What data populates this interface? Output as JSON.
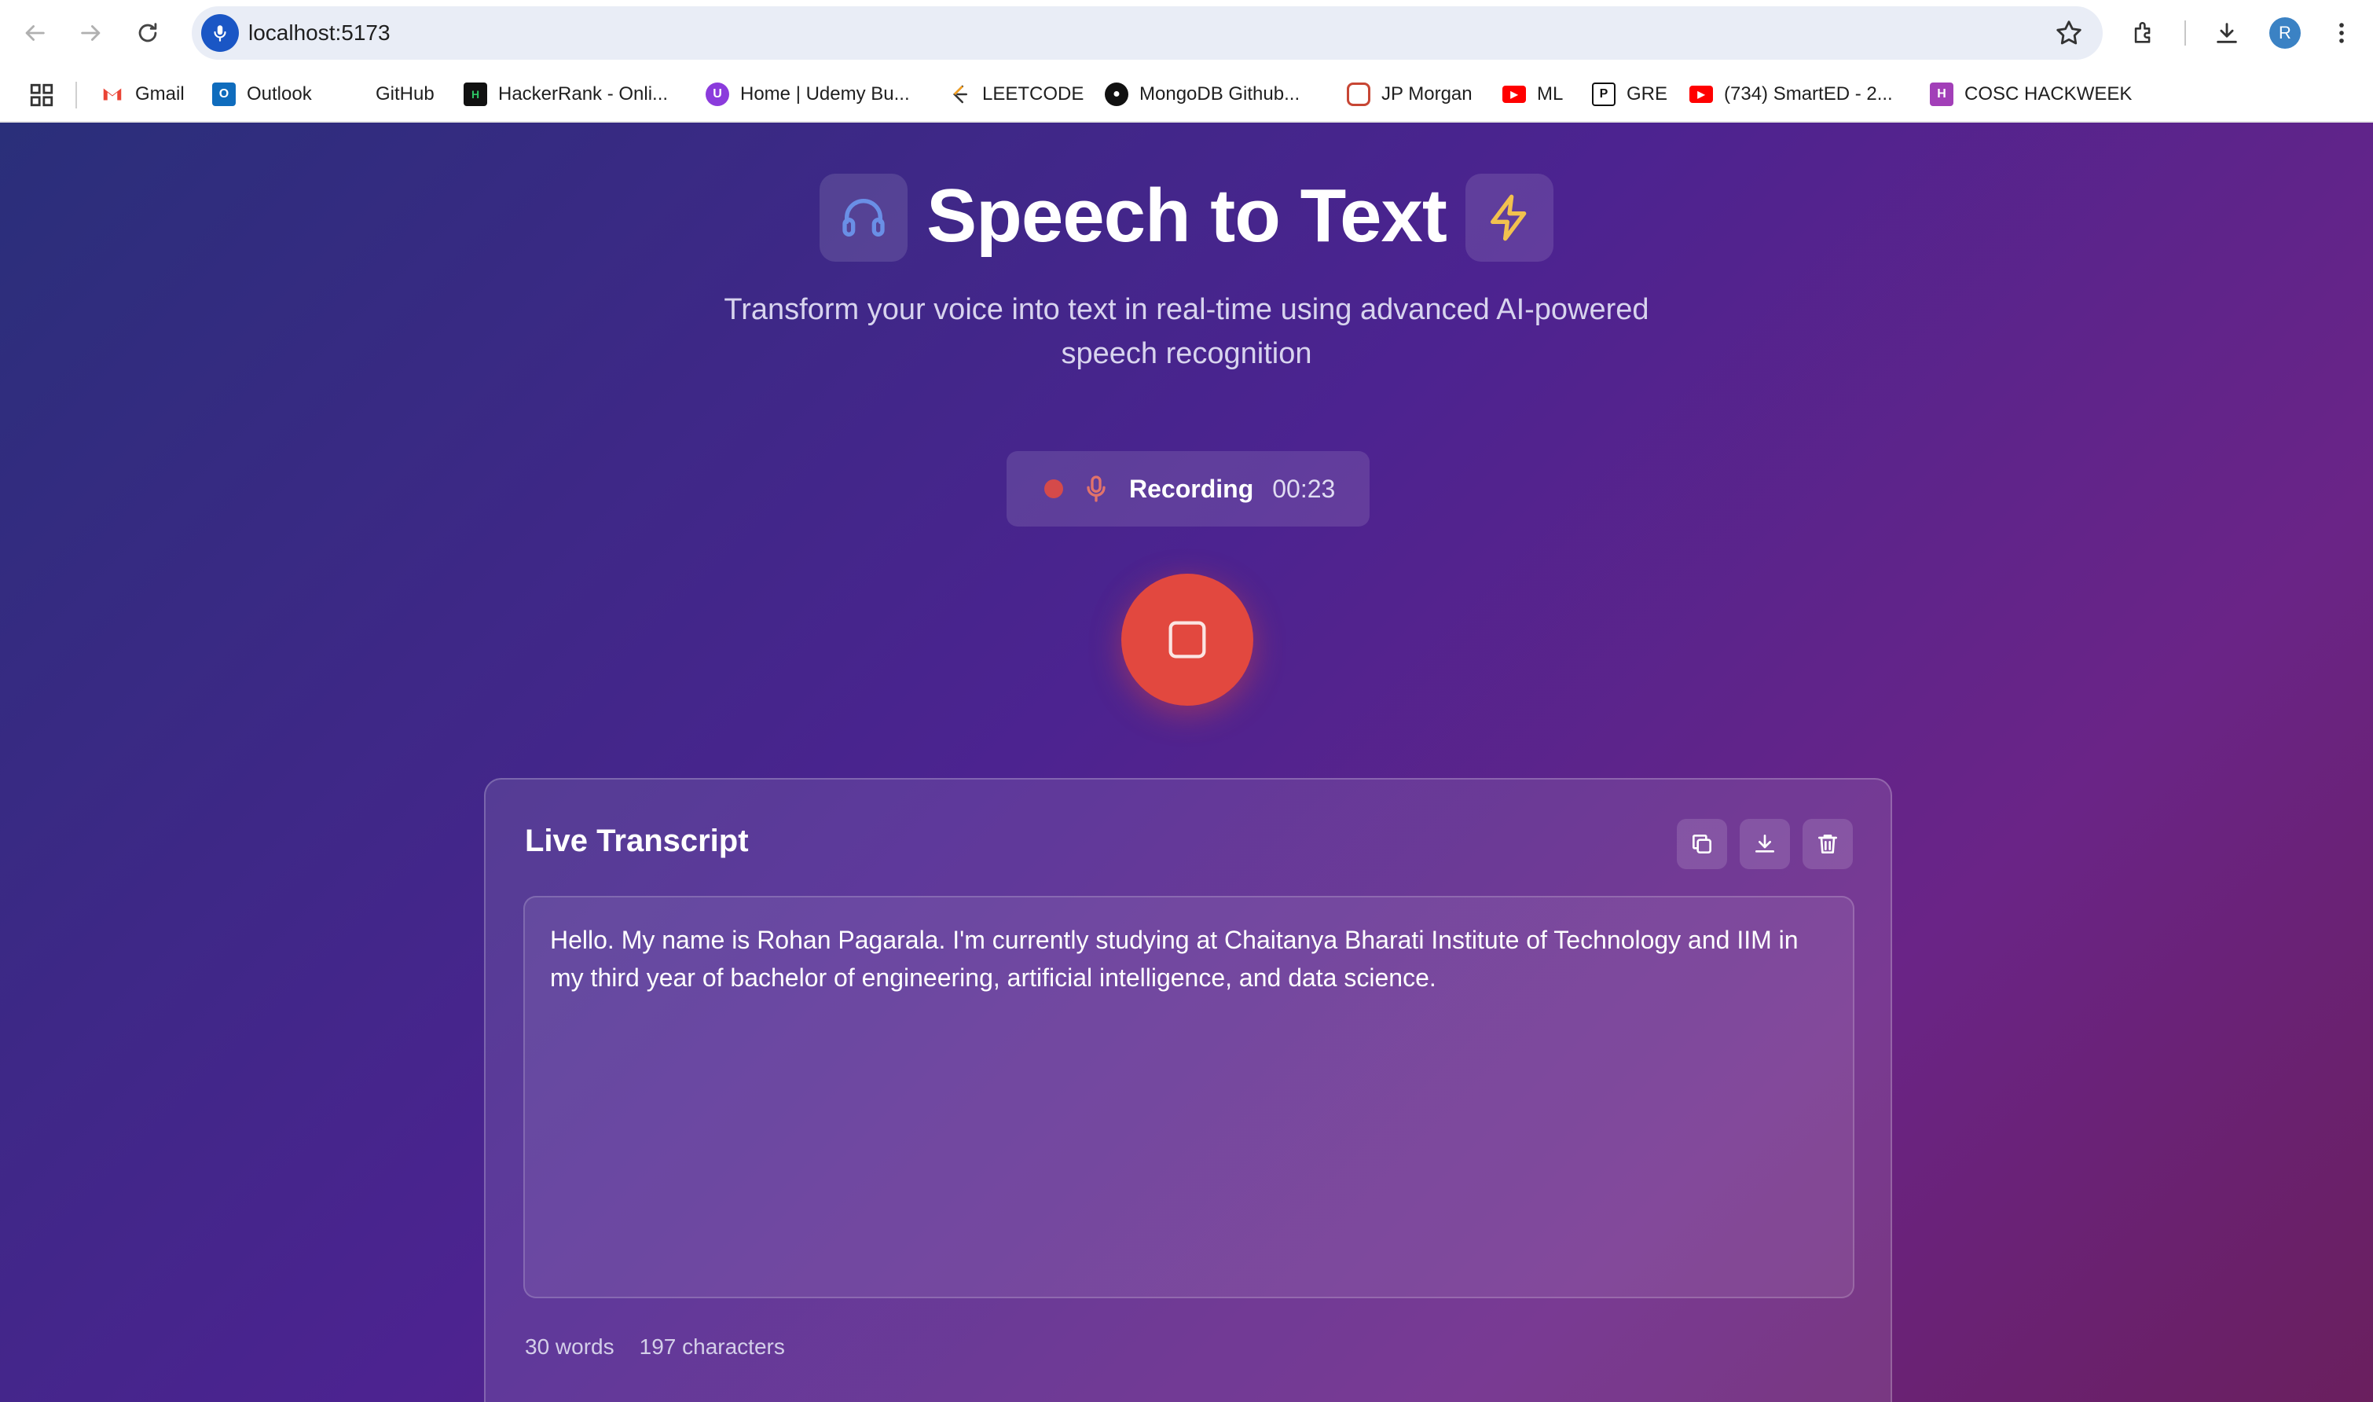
{
  "browser": {
    "url": "localhost:5173",
    "profile_initial": "R",
    "bookmarks": [
      {
        "label": "Gmail",
        "icon": "gmail-icon"
      },
      {
        "label": "Outlook",
        "icon": "outlook-icon"
      },
      {
        "label": "GitHub",
        "icon": "none"
      },
      {
        "label": "HackerRank - Onli...",
        "icon": "hackerrank-icon"
      },
      {
        "label": "Home | Udemy Bu...",
        "icon": "udemy-icon"
      },
      {
        "label": "LEETCODE",
        "icon": "leetcode-icon"
      },
      {
        "label": "MongoDB Github...",
        "icon": "github-icon"
      },
      {
        "label": "JP Morgan",
        "icon": "oracle-icon"
      },
      {
        "label": "ML",
        "icon": "youtube-icon"
      },
      {
        "label": "GRE",
        "icon": "prep-icon"
      },
      {
        "label": "(734) SmartED - 2...",
        "icon": "youtube-icon"
      },
      {
        "label": "COSC HACKWEEK",
        "icon": "hackweek-icon"
      }
    ]
  },
  "header": {
    "title": "Speech to Text",
    "subtitle": "Transform your voice into text in real-time using advanced AI-powered speech recognition",
    "left_icon": "headphones-icon",
    "right_icon": "lightning-icon"
  },
  "recorder": {
    "status": "Recording",
    "timer": "00:23",
    "button_icon": "stop-icon"
  },
  "transcript": {
    "title": "Live Transcript",
    "text": "Hello. My name is Rohan Pagarala. I'm currently studying at Chaitanya Bharati Institute of Technology and IIM in my third year of bachelor of engineering, artificial intelligence, and data science.",
    "word_count": "30 words",
    "char_count": "197 characters",
    "actions": [
      "copy-icon",
      "download-icon",
      "trash-icon"
    ]
  },
  "colors": {
    "accent_red": "#e2483f",
    "headphone_blue": "#6a8fe6",
    "lightning_yellow": "#f2c14e"
  }
}
